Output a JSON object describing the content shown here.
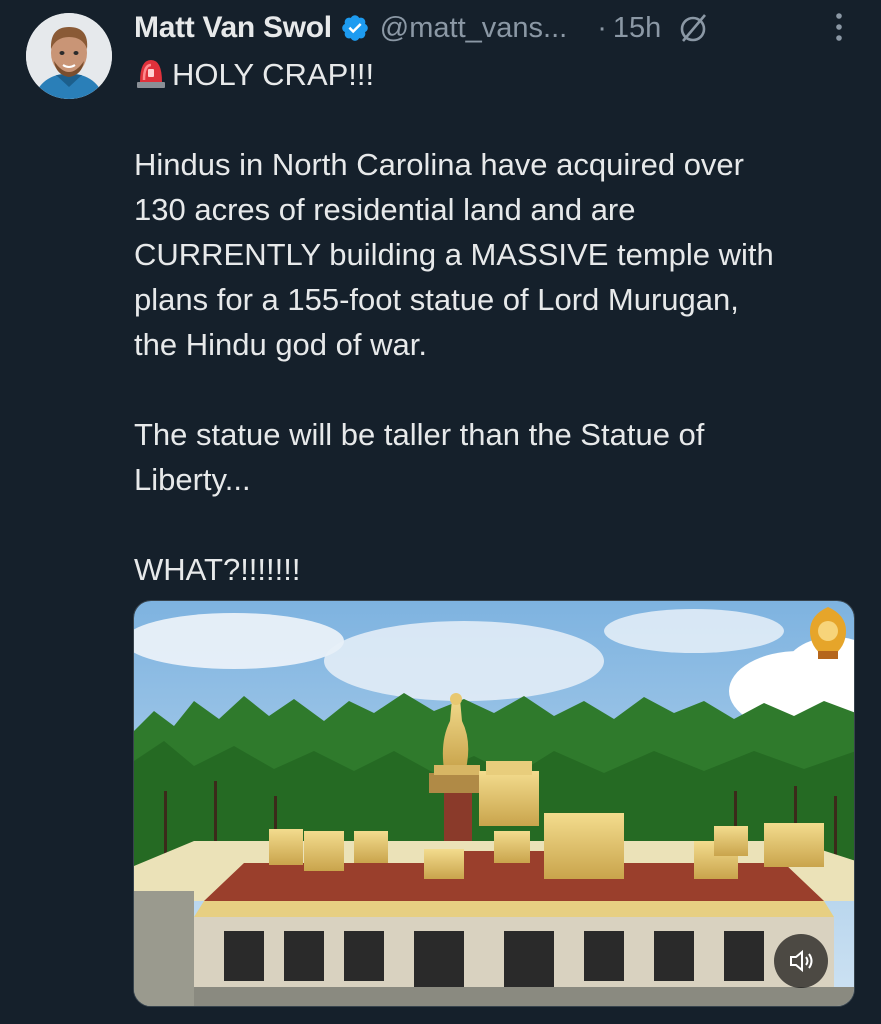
{
  "tweet": {
    "author_name": "Matt Van Swol",
    "handle": "@matt_vans...",
    "separator": "·",
    "time": "15h",
    "lines": [
      "HOLY CRAP!!!",
      "",
      "Hindus in North Carolina have acquired over",
      "130 acres of residential land and are",
      "CURRENTLY building a MASSIVE temple with",
      "plans for a 155-foot statue of Lord Murugan,",
      "the Hindu god of war.",
      "",
      "The statue will be taller than the Statue of",
      "Liberty...",
      "",
      "WHAT?!!!!!!!"
    ]
  },
  "icons": {
    "siren": "police-light-emoji",
    "verified": "verified-badge-icon",
    "grok": "grok-icon",
    "more": "more-options-icon",
    "volume": "volume-muted-icon"
  },
  "colors": {
    "background": "#15202b",
    "text": "#e7e9ea",
    "secondary": "#8b98a5",
    "verified": "#1d9bf0"
  }
}
